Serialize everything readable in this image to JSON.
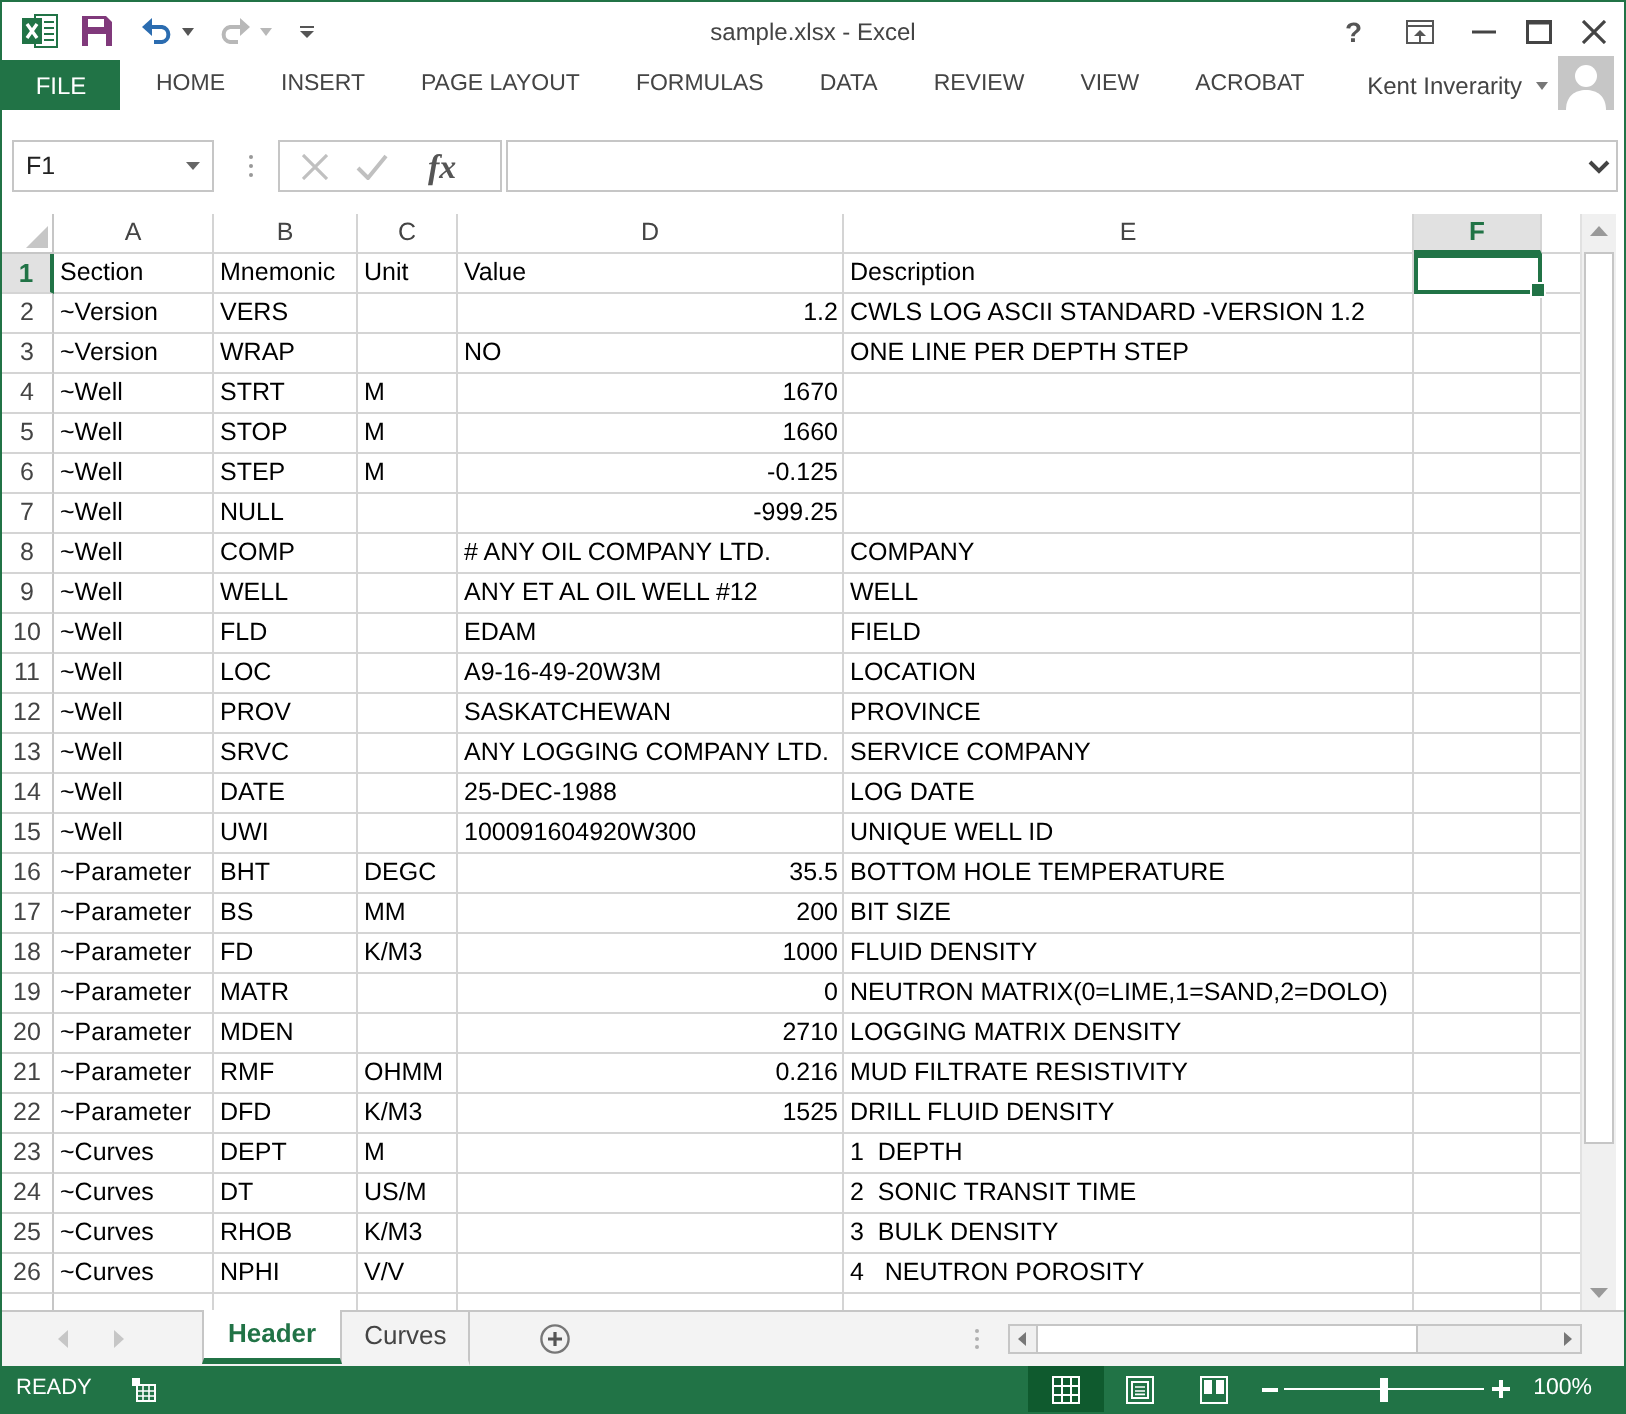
{
  "window": {
    "title": "sample.xlsx - Excel",
    "help": "?"
  },
  "ribbon": {
    "file_tab": "FILE",
    "tabs": [
      "HOME",
      "INSERT",
      "PAGE LAYOUT",
      "FORMULAS",
      "DATA",
      "REVIEW",
      "VIEW",
      "ACROBAT"
    ],
    "user": "Kent Inverarity"
  },
  "formula_bar": {
    "name_box": "F1",
    "function_button": "fx"
  },
  "sheet": {
    "columns": [
      {
        "label": "A",
        "selected": false
      },
      {
        "label": "B",
        "selected": false
      },
      {
        "label": "C",
        "selected": false
      },
      {
        "label": "D",
        "selected": false
      },
      {
        "label": "E",
        "selected": false
      },
      {
        "label": "F",
        "selected": true
      }
    ],
    "rows": [
      {
        "number": "1",
        "selected": true,
        "cells": [
          {
            "kind": "text",
            "text": "Section"
          },
          {
            "kind": "text",
            "text": "Mnemonic"
          },
          {
            "kind": "text",
            "text": "Unit"
          },
          {
            "kind": "text",
            "text": "Value"
          },
          {
            "kind": "text",
            "text": "Description"
          }
        ]
      },
      {
        "number": "2",
        "selected": false,
        "cells": [
          {
            "kind": "text",
            "text": "~Version"
          },
          {
            "kind": "text",
            "text": "VERS"
          },
          null,
          {
            "kind": "number",
            "text": "1.2"
          },
          {
            "kind": "text",
            "text": "CWLS LOG ASCII STANDARD -VERSION 1.2"
          }
        ]
      },
      {
        "number": "3",
        "selected": false,
        "cells": [
          {
            "kind": "text",
            "text": "~Version"
          },
          {
            "kind": "text",
            "text": "WRAP"
          },
          null,
          {
            "kind": "text",
            "text": "NO"
          },
          {
            "kind": "text",
            "text": "ONE LINE PER DEPTH STEP"
          }
        ]
      },
      {
        "number": "4",
        "selected": false,
        "cells": [
          {
            "kind": "text",
            "text": "~Well"
          },
          {
            "kind": "text",
            "text": "STRT"
          },
          {
            "kind": "text",
            "text": "M"
          },
          {
            "kind": "number",
            "text": "1670"
          }
        ]
      },
      {
        "number": "5",
        "selected": false,
        "cells": [
          {
            "kind": "text",
            "text": "~Well"
          },
          {
            "kind": "text",
            "text": "STOP"
          },
          {
            "kind": "text",
            "text": "M"
          },
          {
            "kind": "number",
            "text": "1660"
          }
        ]
      },
      {
        "number": "6",
        "selected": false,
        "cells": [
          {
            "kind": "text",
            "text": "~Well"
          },
          {
            "kind": "text",
            "text": "STEP"
          },
          {
            "kind": "text",
            "text": "M"
          },
          {
            "kind": "number",
            "text": "-0.125"
          }
        ]
      },
      {
        "number": "7",
        "selected": false,
        "cells": [
          {
            "kind": "text",
            "text": "~Well"
          },
          {
            "kind": "text",
            "text": "NULL"
          },
          null,
          {
            "kind": "number",
            "text": "-999.25"
          }
        ]
      },
      {
        "number": "8",
        "selected": false,
        "cells": [
          {
            "kind": "text",
            "text": "~Well"
          },
          {
            "kind": "text",
            "text": "COMP"
          },
          null,
          {
            "kind": "text",
            "text": "# ANY OIL COMPANY LTD."
          },
          {
            "kind": "text",
            "text": "COMPANY"
          }
        ]
      },
      {
        "number": "9",
        "selected": false,
        "cells": [
          {
            "kind": "text",
            "text": "~Well"
          },
          {
            "kind": "text",
            "text": "WELL"
          },
          null,
          {
            "kind": "text",
            "text": "ANY ET AL OIL WELL #12"
          },
          {
            "kind": "text",
            "text": "WELL"
          }
        ]
      },
      {
        "number": "10",
        "selected": false,
        "cells": [
          {
            "kind": "text",
            "text": "~Well"
          },
          {
            "kind": "text",
            "text": "FLD"
          },
          null,
          {
            "kind": "text",
            "text": "EDAM"
          },
          {
            "kind": "text",
            "text": "FIELD"
          }
        ]
      },
      {
        "number": "11",
        "selected": false,
        "cells": [
          {
            "kind": "text",
            "text": "~Well"
          },
          {
            "kind": "text",
            "text": "LOC"
          },
          null,
          {
            "kind": "text",
            "text": "A9-16-49-20W3M"
          },
          {
            "kind": "text",
            "text": "LOCATION"
          }
        ]
      },
      {
        "number": "12",
        "selected": false,
        "cells": [
          {
            "kind": "text",
            "text": "~Well"
          },
          {
            "kind": "text",
            "text": "PROV"
          },
          null,
          {
            "kind": "text",
            "text": "SASKATCHEWAN"
          },
          {
            "kind": "text",
            "text": "PROVINCE"
          }
        ]
      },
      {
        "number": "13",
        "selected": false,
        "cells": [
          {
            "kind": "text",
            "text": "~Well"
          },
          {
            "kind": "text",
            "text": "SRVC"
          },
          null,
          {
            "kind": "text",
            "text": "ANY LOGGING COMPANY LTD."
          },
          {
            "kind": "text",
            "text": "SERVICE COMPANY"
          }
        ]
      },
      {
        "number": "14",
        "selected": false,
        "cells": [
          {
            "kind": "text",
            "text": "~Well"
          },
          {
            "kind": "text",
            "text": "DATE"
          },
          null,
          {
            "kind": "text",
            "text": "25-DEC-1988"
          },
          {
            "kind": "text",
            "text": "LOG DATE"
          }
        ]
      },
      {
        "number": "15",
        "selected": false,
        "cells": [
          {
            "kind": "text",
            "text": "~Well"
          },
          {
            "kind": "text",
            "text": "UWI"
          },
          null,
          {
            "kind": "text",
            "text": "100091604920W300"
          },
          {
            "kind": "text",
            "text": "UNIQUE WELL ID"
          }
        ]
      },
      {
        "number": "16",
        "selected": false,
        "cells": [
          {
            "kind": "text",
            "text": "~Parameter"
          },
          {
            "kind": "text",
            "text": "BHT"
          },
          {
            "kind": "text",
            "text": "DEGC"
          },
          {
            "kind": "number",
            "text": "35.5"
          },
          {
            "kind": "text",
            "text": "BOTTOM HOLE TEMPERATURE"
          }
        ]
      },
      {
        "number": "17",
        "selected": false,
        "cells": [
          {
            "kind": "text",
            "text": "~Parameter"
          },
          {
            "kind": "text",
            "text": "BS"
          },
          {
            "kind": "text",
            "text": "MM"
          },
          {
            "kind": "number",
            "text": "200"
          },
          {
            "kind": "text",
            "text": "BIT SIZE"
          }
        ]
      },
      {
        "number": "18",
        "selected": false,
        "cells": [
          {
            "kind": "text",
            "text": "~Parameter"
          },
          {
            "kind": "text",
            "text": "FD"
          },
          {
            "kind": "text",
            "text": "K/M3"
          },
          {
            "kind": "number",
            "text": "1000"
          },
          {
            "kind": "text",
            "text": "FLUID DENSITY"
          }
        ]
      },
      {
        "number": "19",
        "selected": false,
        "cells": [
          {
            "kind": "text",
            "text": "~Parameter"
          },
          {
            "kind": "text",
            "text": "MATR"
          },
          null,
          {
            "kind": "number",
            "text": "0"
          },
          {
            "kind": "text",
            "text": "NEUTRON MATRIX(0=LIME,1=SAND,2=DOLO)"
          }
        ]
      },
      {
        "number": "20",
        "selected": false,
        "cells": [
          {
            "kind": "text",
            "text": "~Parameter"
          },
          {
            "kind": "text",
            "text": "MDEN"
          },
          null,
          {
            "kind": "number",
            "text": "2710"
          },
          {
            "kind": "text",
            "text": "LOGGING MATRIX DENSITY"
          }
        ]
      },
      {
        "number": "21",
        "selected": false,
        "cells": [
          {
            "kind": "text",
            "text": "~Parameter"
          },
          {
            "kind": "text",
            "text": "RMF"
          },
          {
            "kind": "text",
            "text": "OHMM"
          },
          {
            "kind": "number",
            "text": "0.216"
          },
          {
            "kind": "text",
            "text": "MUD FILTRATE RESISTIVITY"
          }
        ]
      },
      {
        "number": "22",
        "selected": false,
        "cells": [
          {
            "kind": "text",
            "text": "~Parameter"
          },
          {
            "kind": "text",
            "text": "DFD"
          },
          {
            "kind": "text",
            "text": "K/M3"
          },
          {
            "kind": "number",
            "text": "1525"
          },
          {
            "kind": "text",
            "text": "DRILL FLUID DENSITY"
          }
        ]
      },
      {
        "number": "23",
        "selected": false,
        "cells": [
          {
            "kind": "text",
            "text": "~Curves"
          },
          {
            "kind": "text",
            "text": "DEPT"
          },
          {
            "kind": "text",
            "text": "M"
          },
          null,
          {
            "kind": "text",
            "text": "1  DEPTH"
          }
        ]
      },
      {
        "number": "24",
        "selected": false,
        "cells": [
          {
            "kind": "text",
            "text": "~Curves"
          },
          {
            "kind": "text",
            "text": "DT"
          },
          {
            "kind": "text",
            "text": "US/M"
          },
          null,
          {
            "kind": "text",
            "text": "2  SONIC TRANSIT TIME"
          }
        ]
      },
      {
        "number": "25",
        "selected": false,
        "cells": [
          {
            "kind": "text",
            "text": "~Curves"
          },
          {
            "kind": "text",
            "text": "RHOB"
          },
          {
            "kind": "text",
            "text": "K/M3"
          },
          null,
          {
            "kind": "text",
            "text": "3  BULK DENSITY"
          }
        ]
      },
      {
        "number": "26",
        "selected": false,
        "cells": [
          {
            "kind": "text",
            "text": "~Curves"
          },
          {
            "kind": "text",
            "text": "NPHI"
          },
          {
            "kind": "text",
            "text": "V/V"
          },
          null,
          {
            "kind": "text",
            "text": "4   NEUTRON POROSITY"
          }
        ]
      }
    ]
  },
  "sheet_tabs": [
    {
      "label": "Header",
      "selected": true
    },
    {
      "label": "Curves",
      "selected": false
    }
  ],
  "status_bar": {
    "mode": "READY",
    "views": [
      {
        "kind": "normal",
        "selected": true
      },
      {
        "kind": "page_layout",
        "selected": false
      },
      {
        "kind": "page_break",
        "selected": false
      }
    ],
    "zoom_slider": {
      "level": 0.5
    },
    "zoom": "100%"
  }
}
